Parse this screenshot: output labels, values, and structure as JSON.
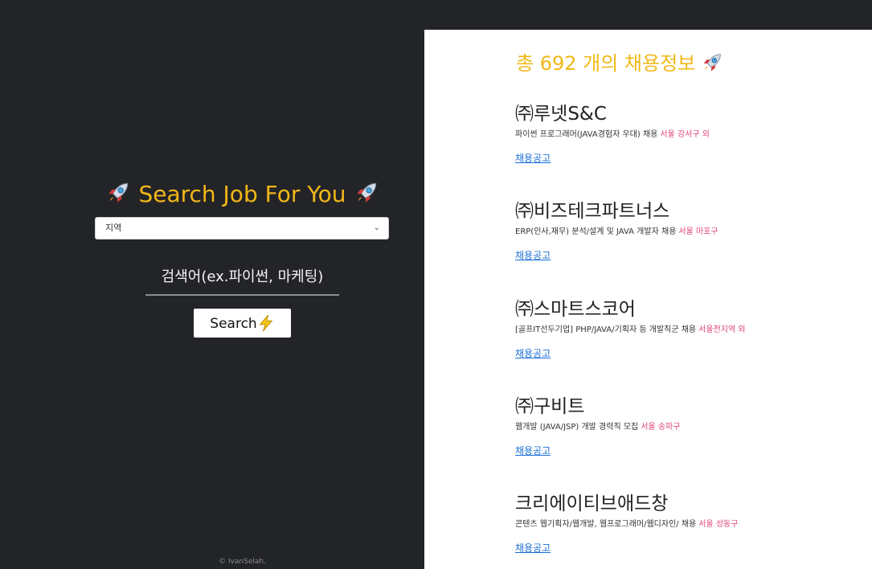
{
  "search": {
    "title": "Search Job For You",
    "region_selected": "지역",
    "keyword_placeholder": "검색어(ex.파이썬, 마케팅)",
    "button_label": "Search",
    "footer": "© IvanSelah."
  },
  "results": {
    "total_title": "총 692 개의 채용정보",
    "jobs": [
      {
        "company": "㈜루넷S&C",
        "desc": "파이썬 프로그래머(JAVA경험자 우대) 채용",
        "location": "서울 강서구 외",
        "link": "채용공고"
      },
      {
        "company": "㈜비즈테크파트너스",
        "desc": "ERP(인사,재무) 분석/설계 및 JAVA 개발자 채용",
        "location": "서울 마포구",
        "link": "채용공고"
      },
      {
        "company": "㈜스마트스코어",
        "desc": "[골프IT선두기업] PHP/JAVA/기획자 등 개발직군 채용",
        "location": "서울전지역 외",
        "link": "채용공고"
      },
      {
        "company": "㈜구비트",
        "desc": "웹개발 (JAVA/JSP) 개발 경력직 모집",
        "location": "서울 송파구",
        "link": "채용공고"
      },
      {
        "company": "크리에이티브애드창",
        "desc": "콘텐츠 웹기획자/웹개발, 웹프로그래머/웹디자인/ 채용",
        "location": "서울 성동구",
        "link": "채용공고"
      }
    ]
  },
  "icons": {
    "rocket": "rocket-icon",
    "bolt": "lightning-icon",
    "chevron": "chevron-down-icon"
  },
  "colors": {
    "accent": "#f2b817",
    "dark_bg": "#232427",
    "link": "#1a6fd6",
    "location": "#e0457b"
  }
}
